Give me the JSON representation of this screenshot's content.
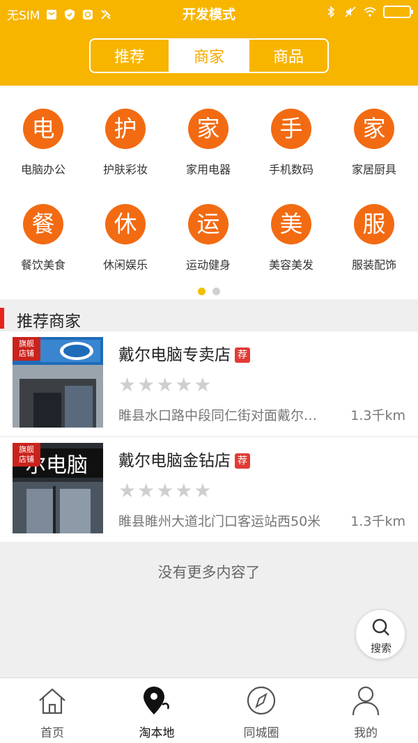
{
  "status_bar": {
    "carrier": "无SIM",
    "title": "开发模式"
  },
  "segments": [
    {
      "label": "推荐",
      "active": false
    },
    {
      "label": "商家",
      "active": true
    },
    {
      "label": "商品",
      "active": false
    }
  ],
  "categories": [
    {
      "glyph": "电",
      "label": "电脑办公"
    },
    {
      "glyph": "护",
      "label": "护肤彩妆"
    },
    {
      "glyph": "家",
      "label": "家用电器"
    },
    {
      "glyph": "手",
      "label": "手机数码"
    },
    {
      "glyph": "家",
      "label": "家居厨具"
    },
    {
      "glyph": "餐",
      "label": "餐饮美食"
    },
    {
      "glyph": "休",
      "label": "休闲娱乐"
    },
    {
      "glyph": "运",
      "label": "运动健身"
    },
    {
      "glyph": "美",
      "label": "美容美发"
    },
    {
      "glyph": "服",
      "label": "服装配饰"
    }
  ],
  "section_title": "推荐商家",
  "stores": [
    {
      "badge": "旗舰店铺",
      "name": "戴尔电脑专卖店",
      "tag": "荐",
      "rating": 0,
      "address": "睢县水口路中段同仁街对面戴尔…",
      "distance": "1.3千km"
    },
    {
      "badge": "旗舰店铺",
      "name": "戴尔电脑金钻店",
      "tag": "荐",
      "rating": 0,
      "address": "睢县睢州大道北门口客运站西50米",
      "distance": "1.3千km"
    }
  ],
  "no_more_text": "没有更多内容了",
  "search_fab": {
    "label": "搜索",
    "icon": "search-icon"
  },
  "bottom_nav": [
    {
      "label": "首页",
      "icon": "home-icon",
      "active": false
    },
    {
      "label": "淘本地",
      "icon": "location-pin-icon",
      "active": true
    },
    {
      "label": "同城圈",
      "icon": "compass-icon",
      "active": false
    },
    {
      "label": "我的",
      "icon": "user-icon",
      "active": false
    }
  ],
  "colors": {
    "header": "#f7b500",
    "category_circle": "#f26b12",
    "section_bar": "#e8221d",
    "badge_red": "#c9231d",
    "page_indicator_active": "#f0c000"
  }
}
